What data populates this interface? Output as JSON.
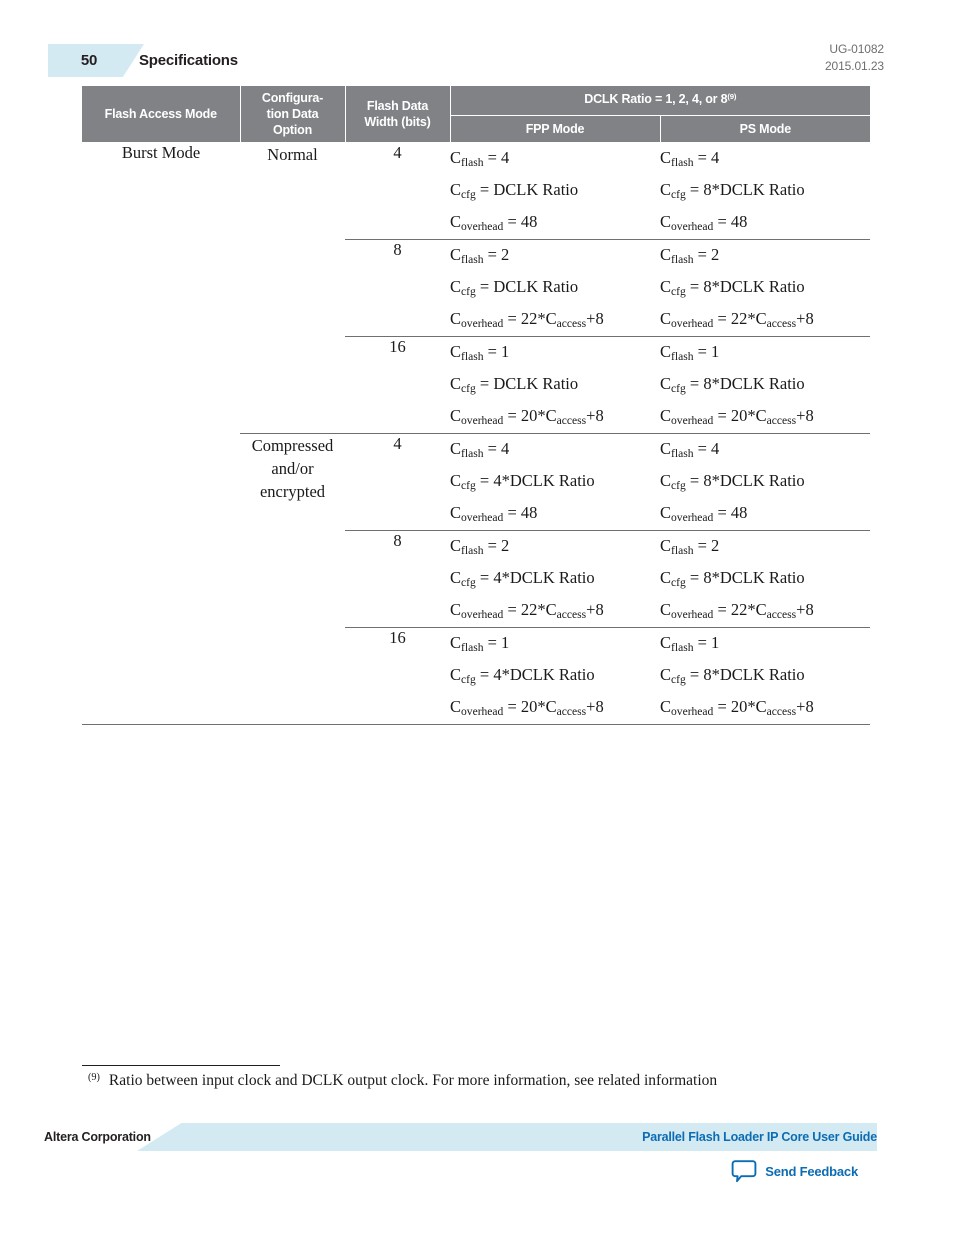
{
  "header": {
    "page_number": "50",
    "chapter_title": "Specifications",
    "doc_id": "UG-01082",
    "doc_date": "2015.01.23",
    "accent_color": "#d4eaf3",
    "meta_color": "#6d6e71"
  },
  "table": {
    "header_bg": "#808285",
    "columns": [
      {
        "label": "Flash Access Mode"
      },
      {
        "label": "Configura-\ntion Data\nOption"
      },
      {
        "label": "Flash Data\nWidth (bits)"
      }
    ],
    "group_header": {
      "label": "DCLK Ratio = 1, 2, 4, or 8",
      "footnote_marker": "(9)"
    },
    "sub_columns": [
      {
        "label": "FPP Mode"
      },
      {
        "label": "PS Mode"
      }
    ],
    "access_mode": "Burst Mode",
    "option_groups": [
      {
        "label": "Normal"
      },
      {
        "label": "Compressed\nand/or\nencrypted"
      }
    ],
    "rows": [
      {
        "width": "4",
        "fpp": [
          {
            "sym": "C",
            "subs": "flash",
            "rhs": "= 4"
          },
          {
            "sym": "C",
            "subs": "cfg",
            "rhs": "= DCLK Ratio"
          },
          {
            "sym": "C",
            "subs": "overhead",
            "rhs": "= 48"
          }
        ],
        "ps": [
          {
            "sym": "C",
            "subs": "flash",
            "rhs": "= 4"
          },
          {
            "sym": "C",
            "subs": "cfg",
            "rhs": "= 8*DCLK Ratio"
          },
          {
            "sym": "C",
            "subs": "overhead",
            "rhs": "= 48"
          }
        ]
      },
      {
        "width": "8",
        "fpp": [
          {
            "sym": "C",
            "subs": "flash",
            "rhs": "= 2"
          },
          {
            "sym": "C",
            "subs": "cfg",
            "rhs": "= DCLK Ratio"
          },
          {
            "sym": "C",
            "subs": "overhead",
            "rhs": "= 22*C",
            "sub2": "access",
            "tail": "+8"
          }
        ],
        "ps": [
          {
            "sym": "C",
            "subs": "flash",
            "rhs": "= 2"
          },
          {
            "sym": "C",
            "subs": "cfg",
            "rhs": "= 8*DCLK Ratio"
          },
          {
            "sym": "C",
            "subs": "overhead",
            "rhs": "= 22*C",
            "sub2": "access",
            "tail": "+8"
          }
        ]
      },
      {
        "width": "16",
        "fpp": [
          {
            "sym": "C",
            "subs": "flash",
            "rhs": "= 1"
          },
          {
            "sym": "C",
            "subs": "cfg",
            "rhs": "= DCLK Ratio"
          },
          {
            "sym": "C",
            "subs": "overhead",
            "rhs": "= 20*C",
            "sub2": "access",
            "tail": "+8"
          }
        ],
        "ps": [
          {
            "sym": "C",
            "subs": "flash",
            "rhs": "= 1"
          },
          {
            "sym": "C",
            "subs": "cfg",
            "rhs": "= 8*DCLK Ratio"
          },
          {
            "sym": "C",
            "subs": "overhead",
            "rhs": "= 20*C",
            "sub2": "access",
            "tail": "+8"
          }
        ]
      },
      {
        "width": "4",
        "fpp": [
          {
            "sym": "C",
            "subs": "flash",
            "rhs": "= 4"
          },
          {
            "sym": "C",
            "subs": "cfg",
            "rhs": "= 4*DCLK Ratio"
          },
          {
            "sym": "C",
            "subs": "overhead",
            "rhs": "= 48"
          }
        ],
        "ps": [
          {
            "sym": "C",
            "subs": "flash",
            "rhs": "= 4"
          },
          {
            "sym": "C",
            "subs": "cfg",
            "rhs": "= 8*DCLK Ratio"
          },
          {
            "sym": "C",
            "subs": "overhead",
            "rhs": "= 48"
          }
        ]
      },
      {
        "width": "8",
        "fpp": [
          {
            "sym": "C",
            "subs": "flash",
            "rhs": "= 2"
          },
          {
            "sym": "C",
            "subs": "cfg",
            "rhs": "= 4*DCLK Ratio"
          },
          {
            "sym": "C",
            "subs": "overhead",
            "rhs": "= 22*C",
            "sub2": "access",
            "tail": "+8"
          }
        ],
        "ps": [
          {
            "sym": "C",
            "subs": "flash",
            "rhs": "= 2"
          },
          {
            "sym": "C",
            "subs": "cfg",
            "rhs": "= 8*DCLK Ratio"
          },
          {
            "sym": "C",
            "subs": "overhead",
            "rhs": "= 22*C",
            "sub2": "access",
            "tail": "+8"
          }
        ]
      },
      {
        "width": "16",
        "fpp": [
          {
            "sym": "C",
            "subs": "flash",
            "rhs": "= 1"
          },
          {
            "sym": "C",
            "subs": "cfg",
            "rhs": "= 4*DCLK Ratio"
          },
          {
            "sym": "C",
            "subs": "overhead",
            "rhs": "= 20*C",
            "sub2": "access",
            "tail": "+8"
          }
        ],
        "ps": [
          {
            "sym": "C",
            "subs": "flash",
            "rhs": "= 1"
          },
          {
            "sym": "C",
            "subs": "cfg",
            "rhs": "= 8*DCLK Ratio"
          },
          {
            "sym": "C",
            "subs": "overhead",
            "rhs": "= 20*C",
            "sub2": "access",
            "tail": "+8"
          }
        ]
      }
    ]
  },
  "footnote": {
    "marker": "(9)",
    "text": "Ratio between input clock and DCLK output clock. For more information, see related information"
  },
  "footer": {
    "company": "Altera Corporation",
    "guide_title": "Parallel Flash Loader IP Core User Guide",
    "feedback_label": "Send Feedback",
    "link_color": "#0c6cb3",
    "band_color": "#d4eaf3"
  }
}
